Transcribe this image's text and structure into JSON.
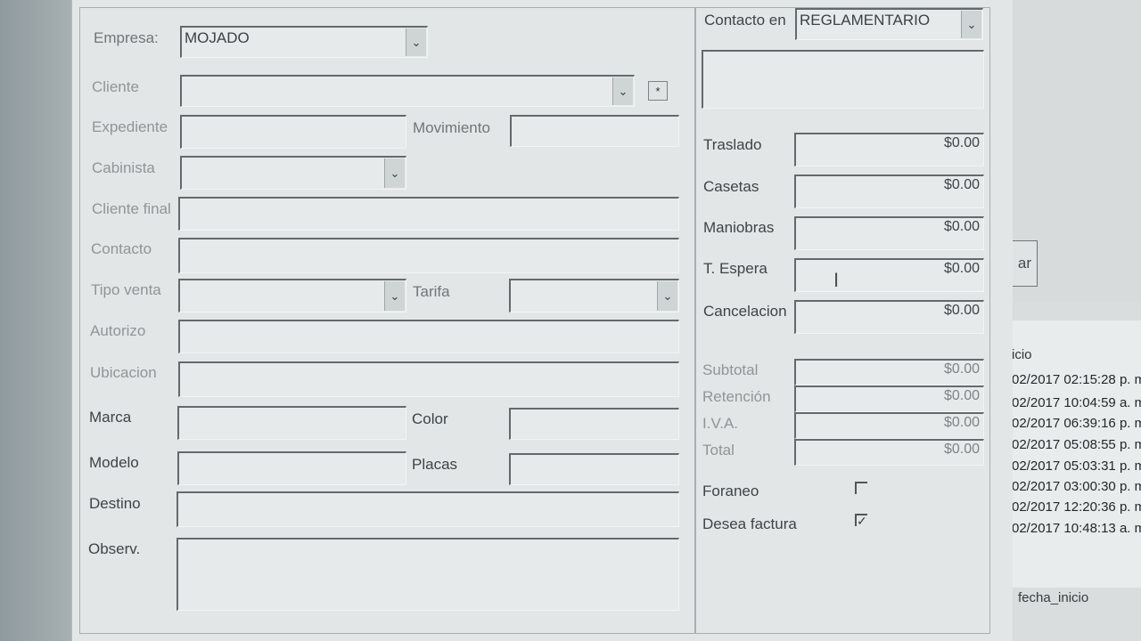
{
  "form": {
    "empresa": {
      "label": "Empresa:",
      "value": "MOJADO"
    },
    "cliente": {
      "label": "Cliente",
      "value": "",
      "button": "*"
    },
    "expediente": {
      "label": "Expediente",
      "value": ""
    },
    "movimiento": {
      "label": "Movimiento",
      "value": ""
    },
    "cabinista": {
      "label": "Cabinista",
      "value": ""
    },
    "cliente_final": {
      "label": "Cliente final",
      "value": ""
    },
    "contacto": {
      "label": "Contacto",
      "value": ""
    },
    "tipo_venta": {
      "label": "Tipo venta",
      "value": ""
    },
    "tarifa": {
      "label": "Tarifa",
      "value": ""
    },
    "autorizo": {
      "label": "Autorizo",
      "value": ""
    },
    "ubicacion": {
      "label": "Ubicacion",
      "value": ""
    },
    "marca": {
      "label": "Marca",
      "value": ""
    },
    "color": {
      "label": "Color",
      "value": ""
    },
    "modelo": {
      "label": "Modelo",
      "value": ""
    },
    "placas": {
      "label": "Placas",
      "value": ""
    },
    "destino": {
      "label": "Destino",
      "value": ""
    },
    "observ": {
      "label": "Observ.",
      "value": ""
    }
  },
  "right": {
    "contacto_en": {
      "label": "Contacto en",
      "value": "REGLAMENTARIO"
    },
    "traslado": {
      "label": "Traslado",
      "value": "$0.00"
    },
    "casetas": {
      "label": "Casetas",
      "value": "$0.00"
    },
    "maniobras": {
      "label": "Maniobras",
      "value": "$0.00"
    },
    "t_espera": {
      "label": "T. Espera",
      "value": "$0.00"
    },
    "cancelacion": {
      "label": "Cancelacion",
      "value": "$0.00"
    },
    "subtotal": {
      "label": "Subtotal",
      "value": "$0.00"
    },
    "retencion": {
      "label": "Retención",
      "value": "$0.00"
    },
    "iva": {
      "label": "I.V.A.",
      "value": "$0.00"
    },
    "total": {
      "label": "Total",
      "value": "$0.00"
    },
    "foraneo": {
      "label": "Foraneo",
      "checked": false
    },
    "desea_factura": {
      "label": "Desea factura",
      "checked": true
    }
  },
  "background_window": {
    "button_text": "ar",
    "grid_header": "icio",
    "rows": [
      "02/2017 02:15:28 p. m",
      "02/2017 10:04:59 a. m",
      "02/2017 06:39:16 p. m",
      "02/2017 05:08:55 p. m",
      "02/2017 05:03:31 p. m",
      "02/2017 03:00:30 p. m",
      "02/2017 12:20:36 p. m",
      "02/2017 10:48:13 a. m"
    ],
    "footer_label": "fecha_inicio"
  },
  "icons": {
    "combo": "chevron-down-icon",
    "checkmark": "check-icon",
    "text_cursor": "i-beam-cursor-icon"
  }
}
